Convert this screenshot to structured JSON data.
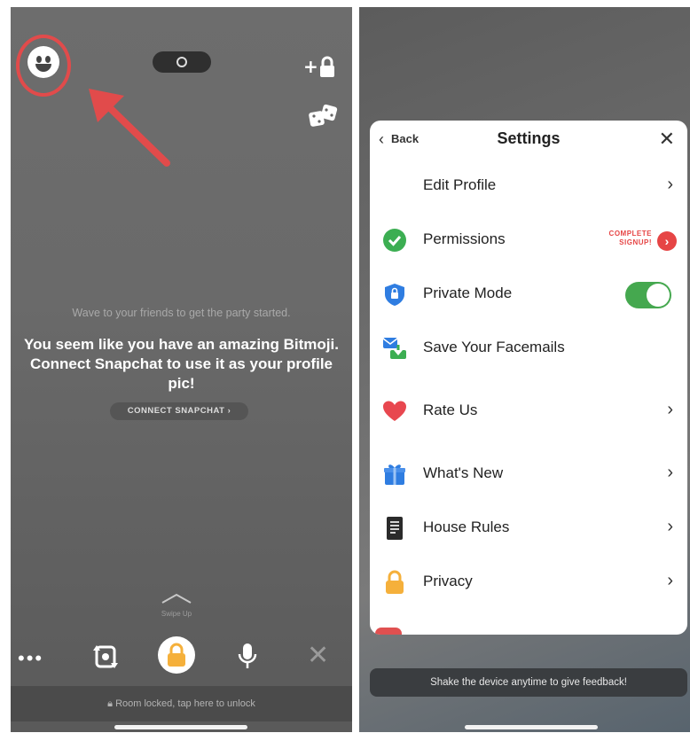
{
  "left": {
    "wave_text": "Wave to your friends to get the party started.",
    "headline": "You seem like you have an amazing Bitmoji. Connect Snapchat to use it as your profile pic!",
    "connect_button": "CONNECT SNAPCHAT ›",
    "swipe_text": "Swipe Up",
    "more_label": "•••",
    "close_label": "✕",
    "locked_text": "Room locked, tap here to unlock",
    "icons": [
      "smiley-face-icon",
      "add-lock-icon",
      "dice-icon",
      "rotate-camera-icon",
      "lock-icon",
      "microphone-icon",
      "close-icon"
    ],
    "colors": {
      "highlight": "#e14b4b",
      "lock_accent": "#f5b03b"
    }
  },
  "right": {
    "back_label": "Back",
    "title": "Settings",
    "close_label": "✕",
    "items": [
      {
        "label": "Edit Profile",
        "icon": "profile-icon"
      },
      {
        "label": "Permissions",
        "icon": "checkmark-icon",
        "badge": "COMPLETE SIGNUP!"
      },
      {
        "label": "Private Mode",
        "icon": "shield-icon",
        "toggle_on": true
      },
      {
        "label": "Save Your Facemails",
        "icon": "facemail-download-icon"
      },
      {
        "label": "Rate Us",
        "icon": "heart-icon"
      },
      {
        "label": "What's New",
        "icon": "gift-icon"
      },
      {
        "label": "House Rules",
        "icon": "document-icon"
      },
      {
        "label": "Privacy",
        "icon": "padlock-icon"
      }
    ],
    "feedback": "Shake the device anytime to give feedback!",
    "colors": {
      "toggle": "#45a84f",
      "badge": "#e64545"
    }
  }
}
